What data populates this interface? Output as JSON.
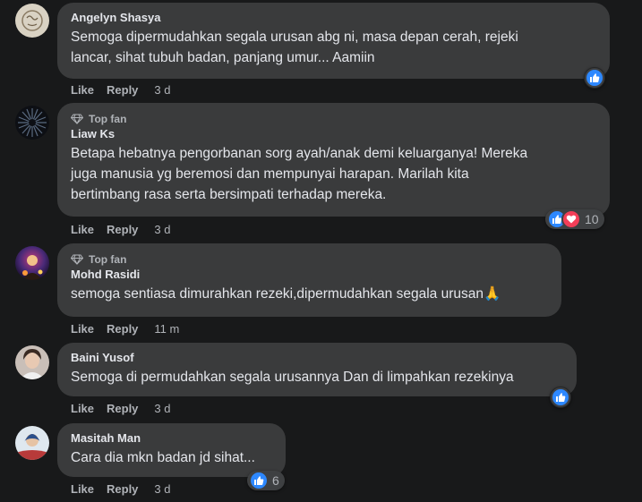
{
  "colors": {
    "background": "#18191a",
    "bubble": "#3a3b3c",
    "primary_text": "#e4e6eb",
    "secondary_text": "#b0b3b8",
    "like_blue": "#2d88ff",
    "love_red": "#f33e58"
  },
  "comments": [
    {
      "author": "Angelyn Shasya",
      "badge": "",
      "text_lines": [
        "Semoga dipermudahkan segala urusan abg ni, masa depan cerah, rejeki",
        "lancar, sihat tubuh badan, panjang umur... Aamiin"
      ],
      "like_label": "Like",
      "reply_label": "Reply",
      "time": "3 d",
      "reactions": [
        "like-icon"
      ],
      "reaction_count": ""
    },
    {
      "author": "Liaw Ks",
      "badge": "Top fan",
      "text_lines": [
        "Betapa hebatnya pengorbanan sorg ayah/anak demi keluarganya! Mereka",
        "juga manusia yg beremosi dan mempunyai harapan. Marilah kita",
        "bertimbang rasa serta bersimpati terhadap mereka."
      ],
      "like_label": "Like",
      "reply_label": "Reply",
      "time": "3 d",
      "reactions": [
        "like-icon",
        "love-icon"
      ],
      "reaction_count": "10"
    },
    {
      "author": "Mohd Rasidi",
      "badge": "Top fan",
      "text_lines": [
        "semoga sentiasa dimurahkan rezeki,dipermudahkan segala urusan🙏"
      ],
      "like_label": "Like",
      "reply_label": "Reply",
      "time": "11 m",
      "reactions": [],
      "reaction_count": ""
    },
    {
      "author": "Baini Yusof",
      "badge": "",
      "text_lines": [
        "Semoga di permudahkan segala urusannya Dan di limpahkan rezekinya"
      ],
      "like_label": "Like",
      "reply_label": "Reply",
      "time": "3 d",
      "reactions": [
        "like-icon"
      ],
      "reaction_count": ""
    },
    {
      "author": "Masitah Man",
      "badge": "",
      "text_lines": [
        "Cara dia mkn badan jd sihat..."
      ],
      "like_label": "Like",
      "reply_label": "Reply",
      "time": "3 d",
      "reactions": [
        "like-icon"
      ],
      "reaction_count": "6"
    }
  ]
}
